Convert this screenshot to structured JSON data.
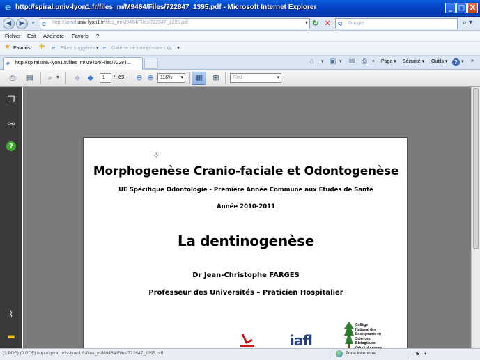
{
  "window": {
    "title": "http://spiral.univ-lyon1.fr/files_m/M9464/Files/722847_1395.pdf - Microsoft Internet Explorer",
    "minimize_glyph": "_",
    "maximize_glyph": "□",
    "close_glyph": "X"
  },
  "address": {
    "url_prefix": "http://spiral.",
    "url_domain": "univ-lyon1.fr",
    "url_path": "/files_m/M9464/Files/722847_1395.pdf",
    "search_engine_glyph": "g",
    "search_placeholder": "Google"
  },
  "menu": {
    "items": [
      "Fichier",
      "Edit",
      "Atteindre",
      "Favoris",
      "?"
    ]
  },
  "favorites": {
    "label": "Favoris",
    "suggested": "Sites suggérés",
    "gallery": "Galerie de composants W..."
  },
  "tabs": {
    "active_label": "http://spiral.univ-lyon1.fr/files_m/M9464/Files/72284..."
  },
  "command_bar": {
    "page": "Page",
    "security": "Sécurité",
    "tools": "Outils"
  },
  "pdf_toolbar": {
    "current_page": "1",
    "page_separator": "/",
    "total_pages": "69",
    "zoom": "116%",
    "find_placeholder": "Find"
  },
  "document": {
    "title": "Morphogenèse Cranio-faciale et Odontogenèse",
    "subtitle": "UE Spécifique Odontologie - Première Année Commune aux Etudes de Santé",
    "year": "Année 2010-2011",
    "main_title": "La dentinogenèse",
    "author": "Dr Jean-Christophe FARGES",
    "role": "Professeur des Universités – Praticien Hospitalier",
    "logo_iafl_text": "iafl",
    "logo_college_text": "Collège\nNational des\nEnseignants en\nSciences\nBiologiques\nOdontologiques"
  },
  "status": {
    "left_text": "(3 PDF) (0 PDF)  http://spiral.univ-lyon1.fr/files_m/M9464/Files/722847_1395.pdf",
    "zone": "Zone inconnue",
    "zoom_glyph": "⊕"
  },
  "colors": {
    "titlebar": "#0545c6",
    "left_panel": "#3a3a3a",
    "doc_background": "#7b7b7b",
    "help_icon": "#3caa2a"
  }
}
